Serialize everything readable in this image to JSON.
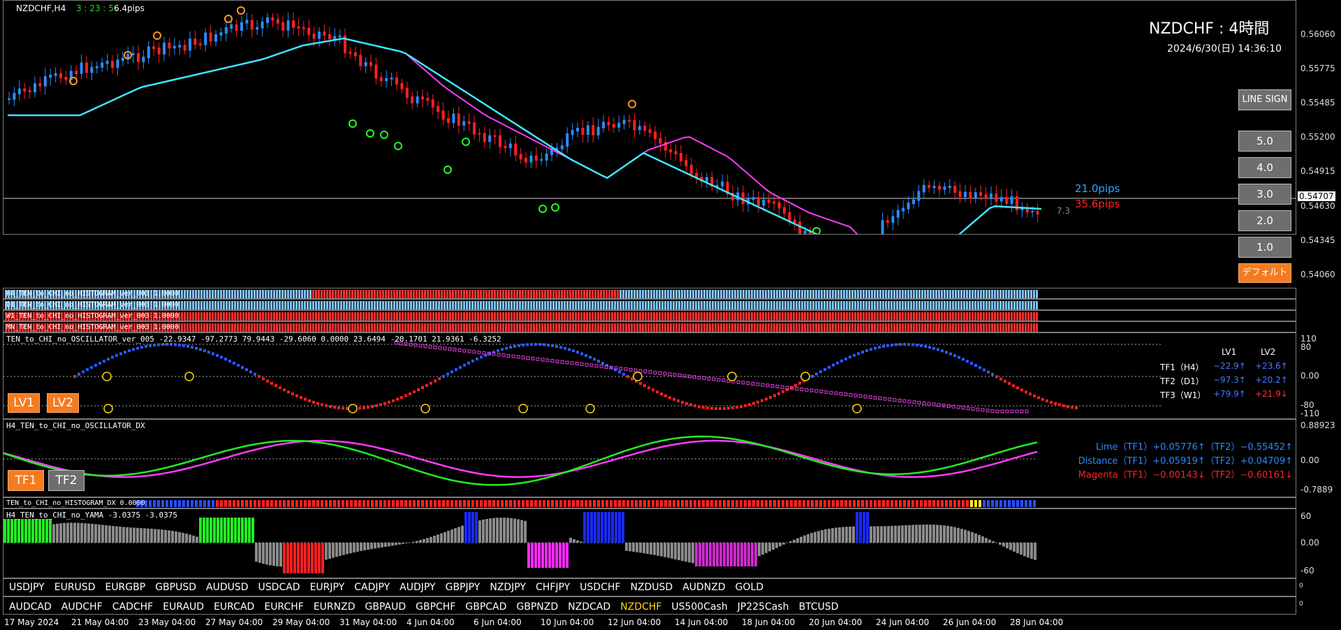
{
  "chart_header": {
    "symbol_tf": "NZDCHF,H4",
    "countdown": "3 : 23 : 5",
    "pips": "6.4pips"
  },
  "title": {
    "main": "NZDCHF : 4時間",
    "datetime": "2024/6/30(日) 14:36:10"
  },
  "price_axis": [
    "0.56060",
    "0.55775",
    "0.55485",
    "0.55200",
    "0.54915",
    "0.54630",
    "0.54345",
    "0.54060"
  ],
  "current_price": "0.54707",
  "right_buttons": {
    "line_sign": "LINE SIGN",
    "levels": [
      "5.0",
      "4.0",
      "3.0",
      "2.0",
      "1.0"
    ],
    "default": "デフォルト"
  },
  "pips_labels": {
    "upper": "21.0pips",
    "lower": "35.6pips",
    "spread": "7.3"
  },
  "histograms": [
    "H4_TEN_to_CHI_no_HISTOGRAM_ver_003 1.0000",
    "D1_TEN_to_CHI_no_HISTOGRAM_ver_003 1.0000",
    "W1_TEN_to_CHI_no_HISTOGRAM_ver_003 1.0000",
    "MN_TEN_to_CHI_no_HISTOGRAM_ver_003 1.0000"
  ],
  "osc": {
    "title": "TEN_to_CHI_no_OSCILLATOR_ver_005 -22.9347 -97.2773 79.9443 -29.6060 0.0000 23.6494 -20.1701 21.9361 -6.3252",
    "axis": [
      "110",
      "80",
      "0.00",
      "-80",
      "-110"
    ],
    "buttons": [
      "LV1",
      "LV2"
    ],
    "table_head": [
      "LV1",
      "LV2"
    ],
    "rows": [
      {
        "label": "TF1（H4）",
        "lv1": "−22.9↑",
        "lv2": "+23.6↑"
      },
      {
        "label": "TF2（D1）",
        "lv1": "−97.3↑",
        "lv2": "+20.2↑"
      },
      {
        "label": "TF3（W1）",
        "lv1": "+79.9↑",
        "lv2": "+21.9↓"
      }
    ],
    "colors": {
      "blue": "#2a5cff",
      "red": "#ff2222",
      "magenta": "#e040e0"
    }
  },
  "dx": {
    "title": "H4_TEN_to_CHI_no_OSCILLATOR_DX",
    "axis": [
      "0.88923",
      "0.00",
      "-0.7889"
    ],
    "buttons": [
      "TF1",
      "TF2"
    ],
    "lines": [
      "Lime（TF1）+0.05776↑（TF2）−0.55452↑",
      "Distance（TF1）+0.05919↑（TF2）+0.04709↑",
      "Magenta（TF1）−0.00143↓（TF2）−0.60161↓"
    ]
  },
  "hist_dx": {
    "title": "TEN_to_CHI_no_HISTOGRAM_DX 0.0000"
  },
  "yama": {
    "title": "H4_TEN_to_CHI_no_YAMA -3.0375 -3.0375",
    "axis": [
      "60",
      "0.00",
      "-60"
    ]
  },
  "symbols_row1": [
    "USDJPY",
    "EURUSD",
    "EURGBP",
    "GBPUSD",
    "AUDUSD",
    "USDCAD",
    "EURJPY",
    "CADJPY",
    "AUDJPY",
    "GBPJPY",
    "NZDJPY",
    "CHFJPY",
    "USDCHF",
    "NZDUSD",
    "AUDNZD",
    "GOLD"
  ],
  "symbols_row2": [
    "AUDCAD",
    "AUDCHF",
    "CADCHF",
    "EURAUD",
    "EURCAD",
    "EURCHF",
    "EURNZD",
    "GBPAUD",
    "GBPCHF",
    "GBPCAD",
    "GBPNZD",
    "NZDCAD",
    "NZDCHF",
    "US500Cash",
    "JP225Cash",
    "BTCUSD"
  ],
  "active_symbol": "NZDCHF",
  "time_axis": [
    "17 May 2024",
    "21 May 04:00",
    "23 May 04:00",
    "27 May 04:00",
    "29 May 04:00",
    "31 May 04:00",
    "4 Jun 04:00",
    "6 Jun 04:00",
    "10 Jun 04:00",
    "12 Jun 04:00",
    "14 Jun 04:00",
    "18 Jun 04:00",
    "20 Jun 04:00",
    "24 Jun 04:00",
    "26 Jun 04:00",
    "28 Jun 04:00"
  ],
  "small_axis": [
    "0",
    "0"
  ]
}
